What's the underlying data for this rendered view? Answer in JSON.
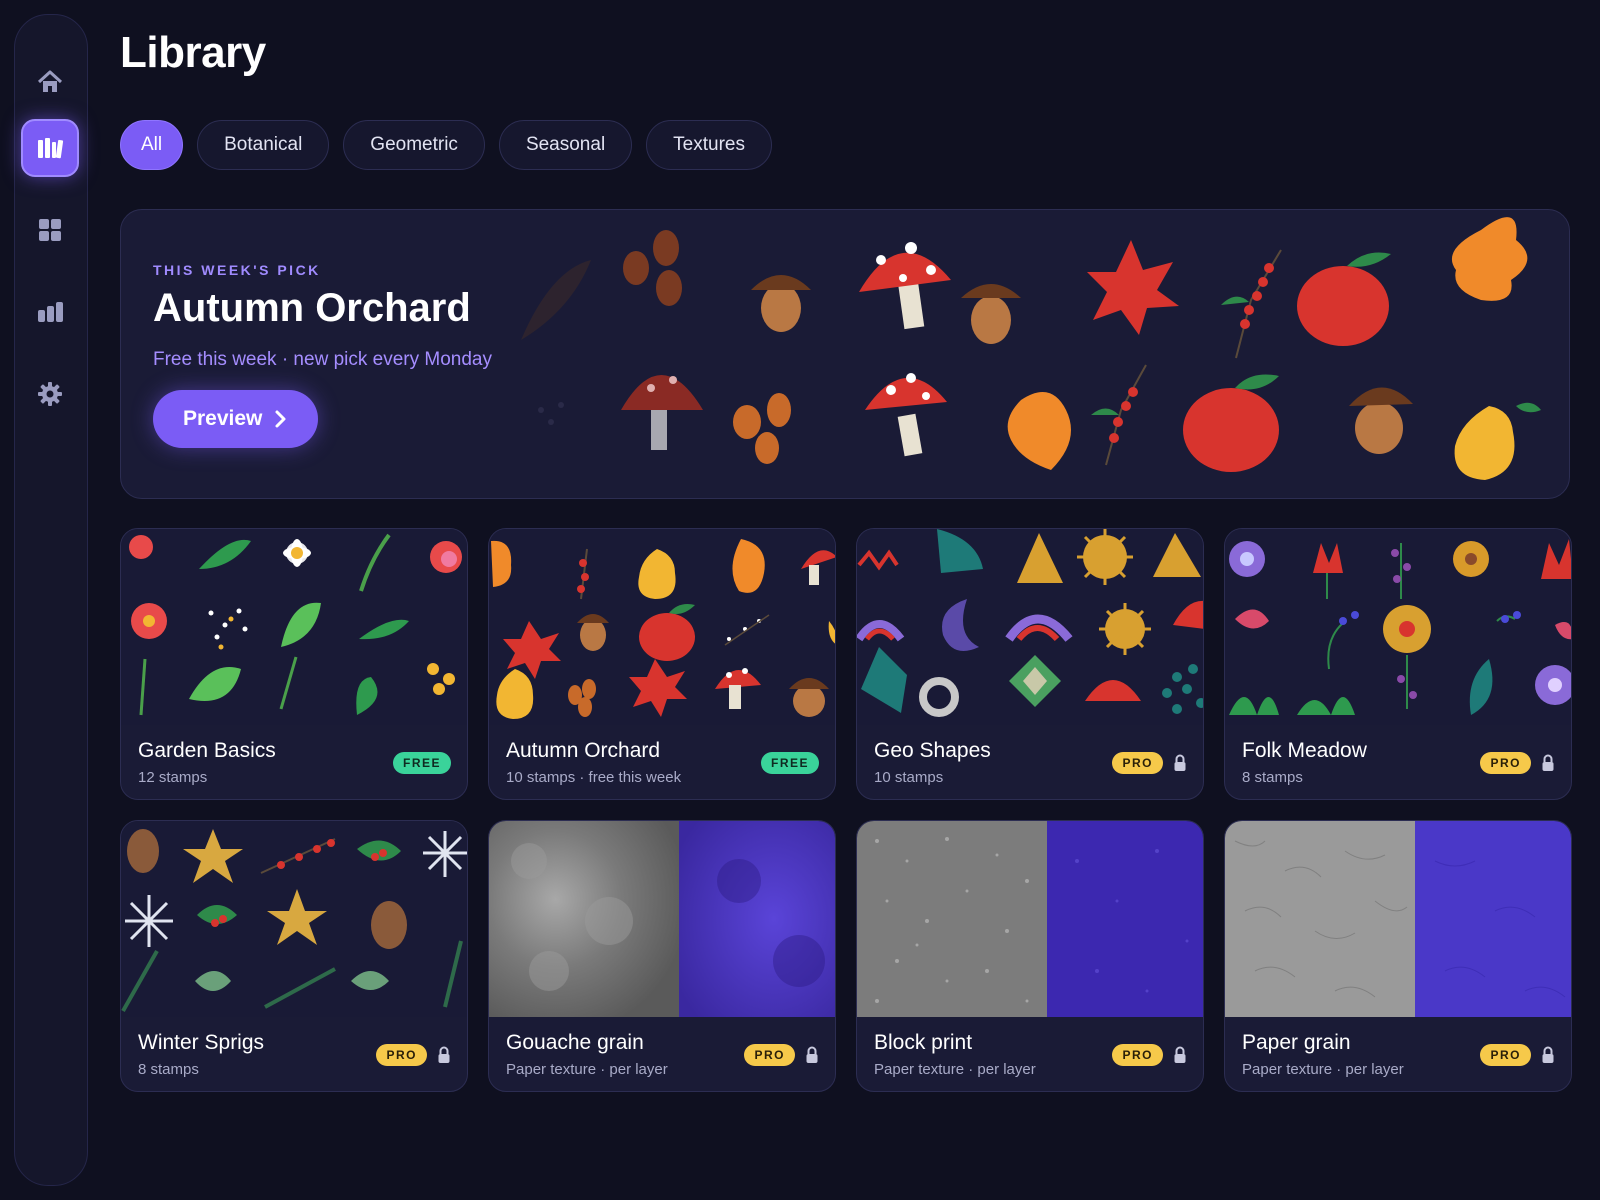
{
  "page": {
    "title": "Library"
  },
  "sidebar": {
    "items": [
      {
        "name": "home",
        "icon": "home-icon",
        "active": false
      },
      {
        "name": "library",
        "icon": "library-icon",
        "active": true
      },
      {
        "name": "grid",
        "icon": "grid-icon",
        "active": false
      },
      {
        "name": "stats",
        "icon": "stats-icon",
        "active": false
      },
      {
        "name": "settings",
        "icon": "gear-icon",
        "active": false
      }
    ]
  },
  "tabs": [
    {
      "label": "All",
      "active": true
    },
    {
      "label": "Botanical",
      "active": false
    },
    {
      "label": "Geometric",
      "active": false
    },
    {
      "label": "Seasonal",
      "active": false
    },
    {
      "label": "Textures",
      "active": false
    }
  ],
  "hero": {
    "eyebrow": "THIS WEEK'S PICK",
    "title": "Autumn Orchard",
    "subtitle": "Free this week · new pick every Monday",
    "button_label": "Preview"
  },
  "cards": [
    {
      "title": "Garden Basics",
      "meta": "12 stamps",
      "badge": "FREE",
      "locked": false
    },
    {
      "title": "Autumn Orchard",
      "meta": "10 stamps · free this week",
      "badge": "FREE",
      "locked": false
    },
    {
      "title": "Geo Shapes",
      "meta": "10 stamps",
      "badge": "PRO",
      "locked": true
    },
    {
      "title": "Folk Meadow",
      "meta": "8 stamps",
      "badge": "PRO",
      "locked": true
    },
    {
      "title": "Winter Sprigs",
      "meta": "8 stamps",
      "badge": "PRO",
      "locked": true
    },
    {
      "title": "Gouache grain",
      "meta": "Paper texture · per layer",
      "badge": "PRO",
      "locked": true
    },
    {
      "title": "Block print",
      "meta": "Paper texture · per layer",
      "badge": "PRO",
      "locked": true
    },
    {
      "title": "Paper grain",
      "meta": "Paper texture · per layer",
      "badge": "PRO",
      "locked": true
    }
  ],
  "colors": {
    "background": "#0f1020",
    "surface": "#1a1b36",
    "accent": "#7b5cf5",
    "free_badge": "#3ad39a",
    "pro_badge": "#f6c94a",
    "texture_purple": "#4a35c8"
  }
}
